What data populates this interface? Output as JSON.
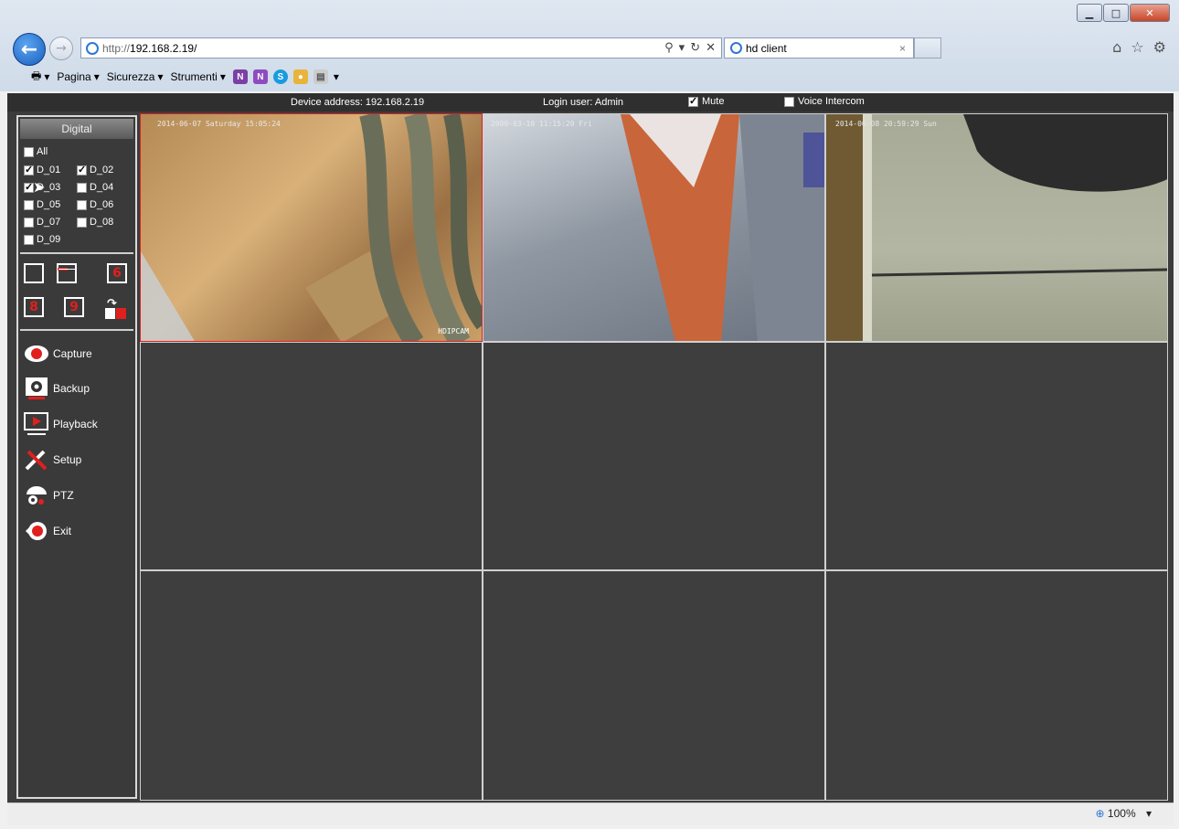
{
  "browser": {
    "url_prefix": "http://",
    "url_host": "192.168.2.19/",
    "tab_title": "hd client",
    "tab_close": "×",
    "command_bar": {
      "page_menu": "Pagina",
      "security_menu": "Sicurezza",
      "tools_menu": "Strumenti"
    },
    "zoom": "100%"
  },
  "app": {
    "device_address": "Device address: 192.168.2.19",
    "login_user": "Login user: Admin",
    "mute_label": "Mute",
    "mute_checked": true,
    "voice_intercom_label": "Voice Intercom",
    "voice_intercom_checked": false,
    "channels_header": "Digital",
    "all_label": "All",
    "channels": [
      {
        "label": "D_01",
        "checked": true
      },
      {
        "label": "D_02",
        "checked": true
      },
      {
        "label": "D_03",
        "checked": true
      },
      {
        "label": "D_04",
        "checked": false
      },
      {
        "label": "D_05",
        "checked": false
      },
      {
        "label": "D_06",
        "checked": false
      },
      {
        "label": "D_07",
        "checked": false
      },
      {
        "label": "D_08",
        "checked": false
      },
      {
        "label": "D_09",
        "checked": false
      }
    ],
    "layouts": {
      "six": "6",
      "eight": "8",
      "nine": "9"
    },
    "menu": {
      "capture": "Capture",
      "backup": "Backup",
      "playback": "Playback",
      "setup": "Setup",
      "ptz": "PTZ",
      "exit": "Exit"
    },
    "videos": [
      {
        "timestamp": "2014-06-07 Saturday 15:05:24",
        "watermark": "HDIPCAM"
      },
      {
        "timestamp": "2000-03-10 11:15:20 Fri",
        "watermark": ""
      },
      {
        "timestamp": "2014-06-08 20:59:29 Sun",
        "watermark": ""
      }
    ]
  },
  "colors": {
    "accent_red": "#e0201e",
    "panel_bg": "#3c3c3c",
    "ie_blue": "#2b78d6"
  }
}
